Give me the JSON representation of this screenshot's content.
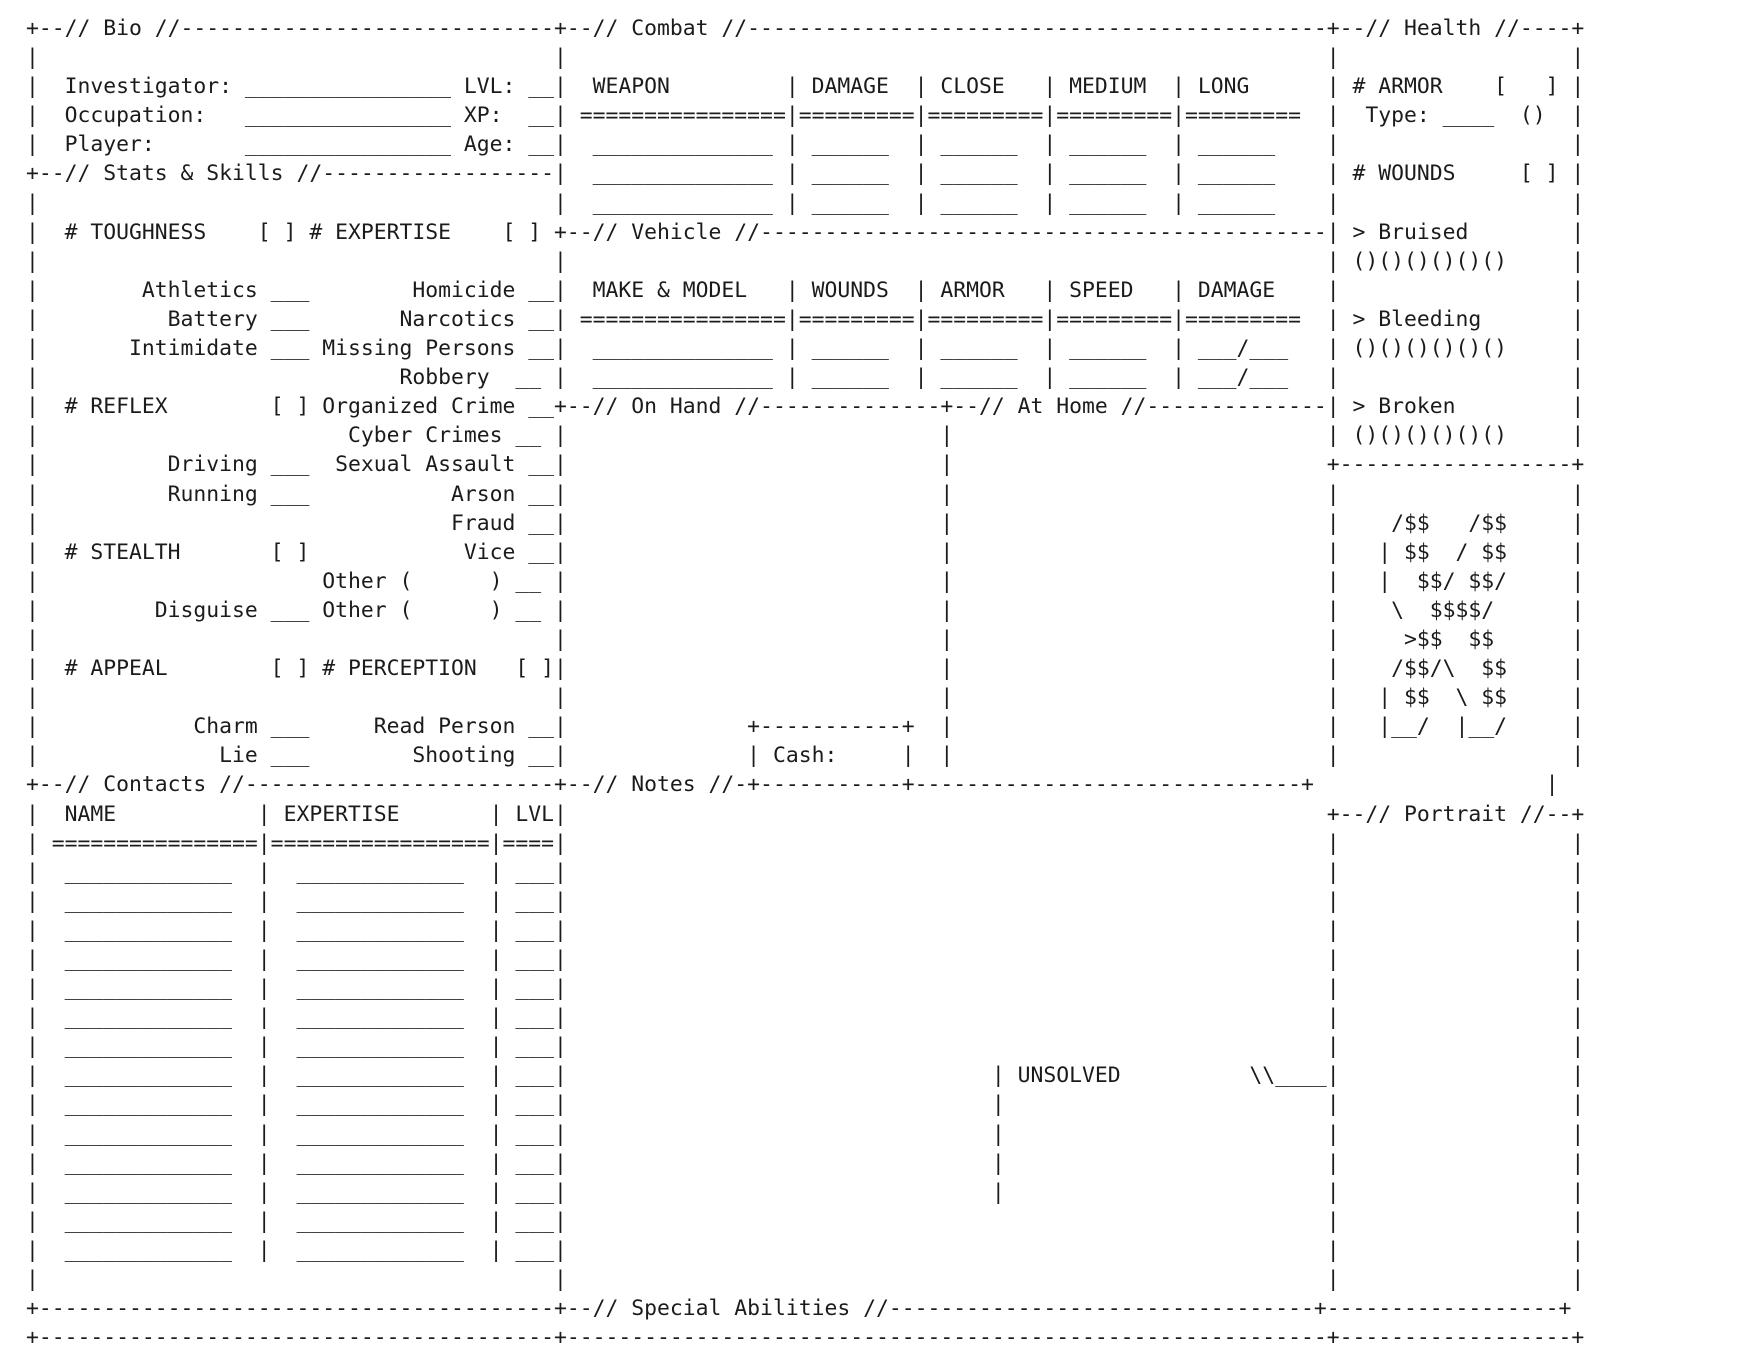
{
  "document": {
    "title": "Investigator Character Sheet",
    "style": "ascii-art",
    "text_color": "#1b1b1b",
    "background_color": "#ffffff"
  },
  "sections": {
    "bio": {
      "header": "+--// Bio //",
      "fields": [
        {
          "label": "Investigator:",
          "value": "",
          "blank": "________________"
        },
        {
          "label": "Occupation:",
          "value": "",
          "blank": "________________"
        },
        {
          "label": "Player:",
          "value": "",
          "blank": "________________"
        },
        {
          "label": "LVL:",
          "value": "",
          "blank": "___"
        },
        {
          "label": "XP:",
          "value": "",
          "blank": "___"
        },
        {
          "label": "Age:",
          "value": "",
          "blank": "___"
        }
      ]
    },
    "stats_skills": {
      "header": "+--// Stats & Skills //",
      "attributes": [
        {
          "name": "# TOUGHNESS",
          "box": "[ ]"
        },
        {
          "name": "# REFLEX",
          "box": "[ ]"
        },
        {
          "name": "# STEALTH",
          "box": "[ ]"
        },
        {
          "name": "# APPEAL",
          "box": "[ ]"
        },
        {
          "name": "# EXPERTISE",
          "box": "[ ]"
        },
        {
          "name": "# PERCEPTION",
          "box": "[ ]"
        }
      ],
      "left_skills": [
        {
          "name": "Athletics",
          "value": "",
          "under": "# TOUGHNESS"
        },
        {
          "name": "Battery",
          "value": "",
          "under": "# TOUGHNESS"
        },
        {
          "name": "Intimidate",
          "value": "",
          "under": "# TOUGHNESS"
        },
        {
          "name": "Driving",
          "value": "",
          "under": "# REFLEX"
        },
        {
          "name": "Running",
          "value": "",
          "under": "# REFLEX"
        },
        {
          "name": "Disguise",
          "value": "",
          "under": "# STEALTH"
        },
        {
          "name": "Charm",
          "value": "",
          "under": "# APPEAL"
        },
        {
          "name": "Lie",
          "value": "",
          "under": "# APPEAL"
        }
      ],
      "expertise_skills": [
        {
          "name": "Homicide",
          "value": ""
        },
        {
          "name": "Narcotics",
          "value": ""
        },
        {
          "name": "Missing Persons",
          "value": ""
        },
        {
          "name": "Robbery",
          "value": ""
        },
        {
          "name": "Organized Crime",
          "value": ""
        },
        {
          "name": "Cyber Crimes",
          "value": ""
        },
        {
          "name": "Sexual Assault",
          "value": ""
        },
        {
          "name": "Arson",
          "value": ""
        },
        {
          "name": "Fraud",
          "value": ""
        },
        {
          "name": "Vice",
          "value": ""
        },
        {
          "name": "Other (        )",
          "value": ""
        },
        {
          "name": "Other (        )",
          "value": ""
        }
      ],
      "perception_skills": [
        {
          "name": "Read Person",
          "value": ""
        },
        {
          "name": "Shooting",
          "value": ""
        }
      ]
    },
    "contacts": {
      "header": "+--// Contacts //",
      "columns": [
        "NAME",
        "EXPERTISE",
        "LVL."
      ],
      "row_count": 14,
      "rows": []
    },
    "combat": {
      "header": "+--// Combat //",
      "columns": [
        "WEAPON",
        "DAMAGE",
        "CLOSE",
        "MEDIUM",
        "LONG"
      ],
      "row_count": 3,
      "rows": []
    },
    "vehicle": {
      "header": "+--// Vehicle //",
      "columns": [
        "MAKE & MODEL",
        "WOUNDS",
        "ARMOR",
        "SPEED",
        "DAMAGE"
      ],
      "row_count": 2,
      "rows": [],
      "damage_format": "___/___"
    },
    "on_hand": {
      "header": "+--// On Hand //",
      "content": ""
    },
    "at_home": {
      "header": "+--// At Home //",
      "content": ""
    },
    "cash": {
      "label": "Cash:",
      "value": ""
    },
    "notes": {
      "header": "+--// Notes //",
      "content": ""
    },
    "unsolved": {
      "label": "UNSOLVED",
      "tail": "\\\\__________",
      "content": ""
    },
    "special_abilities": {
      "header": "+--// Special Abilities //",
      "content": ""
    },
    "health": {
      "header": "+--// Health //",
      "armor": {
        "label": "# ARMOR",
        "box": "[   ]"
      },
      "armor_type": {
        "label": "Type:",
        "blank": "____",
        "paren": "()"
      },
      "wounds": {
        "label": "# WOUNDS",
        "box": "[ ]"
      },
      "tracks": [
        {
          "label": "> Bruised",
          "pips": "()()()()()()",
          "pip_count": 6
        },
        {
          "label": "> Bleeding",
          "pips": "()()()()()()",
          "pip_count": 6
        },
        {
          "label": "> Broken",
          "pips": "()()()()()()",
          "pip_count": 6
        }
      ]
    },
    "logo": {
      "name": "dollar-sign-ascii-art",
      "lines": [
        " /$$   /$$",
        "| $$  / $$",
        "|  $$/ $$/",
        " \\  $$$$/",
        "  >$$  $$",
        " /$$/\\  $$",
        "| $$  \\ $$",
        "|__/  |__/"
      ]
    },
    "portrait": {
      "header": "+--// Portrait //",
      "content": ""
    }
  },
  "ascii": {
    "lines": [
      "+--// Bio //-----------------------------+--// Combat //----------------------------------+--// Health //---+",
      "|                                        |                                                |                 |",
      "|  Investigator: ________________ LVL: __|  WEAPON         | DAMAGE  | CLOSE   | MEDIUM  | LONG    | # ARMOR    [   ] |",
      "|  Occupation:   ________________ XP:  __| ================|=========|=========|=========|=========|  Type: ____  () |",
      "|  Player:       ________________ Age: __|  ______________ | ______  | ______  | ______  | ______  |                 |",
      "+--// Stats & Skills //------------------+  ______________ | ______  | ______  | ______  | ______  | # WOUNDS    [ ] |",
      "|                                        |  ______________ | ______  | ______  | ______  | ______  |                 |",
      "|  # TOUGHNESS      [ ] # EXPERTISE   [ ]+--// Vehicle //---------------------------------+ > Bruised        |",
      "|                                        |                                                |  ()()()()()()   |",
      "|       Athletics ___       Homicide ___ |  MAKE & MODEL   | WOUNDS  | ARMOR   | SPEED   | DAMAGE  |          |",
      "|         Battery ___      Narcotics ___ | ================|=========|=========|=========|=========| > Bleeding      |",
      "|      Intimidate ___ Missing Persons ___|  ______________ | ______  | ______  | ______  | ___/___ |  ()()()()()()   |",
      "|                           Robbery  ___ |  ______________ | ______  | ______  | ______  | ___/___ |                 |",
      "|  # REFLEX         [ ] Organized Crime _+--// On Hand //-------------+--// At Home //-----------------+ > Broken     |",
      "|                         Cyber Crimes __|                            |                                |  ()()()()()()|",
      "|         Driving ___  Sexual Assault ___|                            |                                +-------------+",
      "|         Running ___           Arson ___|                            |                                |             |",
      "|                               Fraud ___|                            |                                |   /$$   /$$ |",
      "|  # STEALTH        [ ]          Vice ___|                            |                                |  | $$  / $$ |",
      "|                      Other (       ) __|                            |                                |  |  $$/ $$/ |",
      "|        Disguise ___  Other (       ) __|                            |                                |   \\  $$$$/  |",
      "|                                        |                            |                                |    >$$  $$  |",
      "|  # APPEAL         [ ] # PERCEPTION  [ ]|                            |                                |   /$$/\\  $$ |",
      "|                                        |                  +-----------+                              |  | $$  \\ $$ |",
      "|          Charm ___      Read Person ___|                  | Cash:     |                              |  |__/  |__/ |",
      "+--// Contacts //------------------------+--// Notes //-----+-----------+------------------------------+             |",
      "|  NAME           | EXPERTISE       | LVL.|                                                            +--// Portrait //-+",
      "| ================|=================|=====|                                                            |                 |",
      "|  _____________  |  _____________  | ____|                                                            |                 |",
      "|  _____________  |  _____________  | ____|                 | UNSOLVED          \\\\__________           |                 |",
      "+----------------------------------------+--// Special Abilities //--+-------------------------------+-----------------+"
    ]
  }
}
